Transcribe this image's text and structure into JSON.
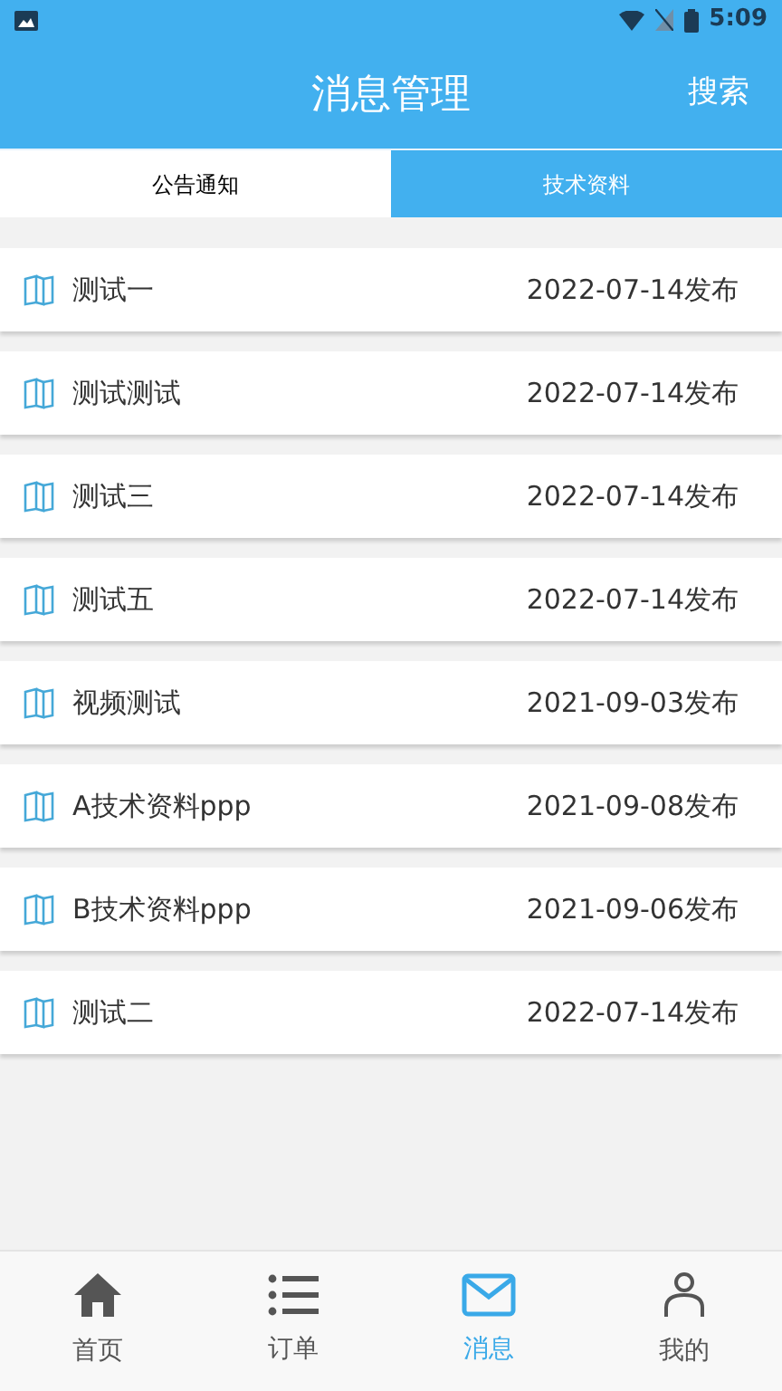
{
  "status_bar": {
    "time": "5:09"
  },
  "header": {
    "title": "消息管理",
    "action": "搜索"
  },
  "tabs": [
    {
      "label": "公告通知",
      "selected": false
    },
    {
      "label": "技术资料",
      "selected": true
    }
  ],
  "items": [
    {
      "title": "测试一",
      "date": "2022-07-14发布"
    },
    {
      "title": "测试测试",
      "date": "2022-07-14发布"
    },
    {
      "title": "测试三",
      "date": "2022-07-14发布"
    },
    {
      "title": "测试五",
      "date": "2022-07-14发布"
    },
    {
      "title": "视频测试",
      "date": "2021-09-03发布"
    },
    {
      "title": "A技术资料ppp",
      "date": "2021-09-08发布"
    },
    {
      "title": "B技术资料ppp",
      "date": "2021-09-06发布"
    },
    {
      "title": "测试二",
      "date": "2022-07-14发布"
    }
  ],
  "bottom_nav": [
    {
      "label": "首页",
      "kind": "home",
      "selected": false
    },
    {
      "label": "订单",
      "kind": "list",
      "selected": false
    },
    {
      "label": "消息",
      "kind": "mail",
      "selected": true
    },
    {
      "label": "我的",
      "kind": "person",
      "selected": false
    }
  ]
}
